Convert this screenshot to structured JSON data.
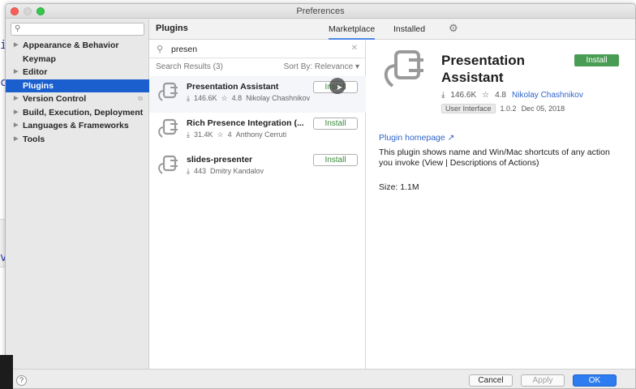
{
  "window": {
    "title": "Preferences"
  },
  "sidebar": {
    "search_placeholder": "",
    "items": [
      {
        "label": "Appearance & Behavior",
        "expandable": true
      },
      {
        "label": "Keymap",
        "expandable": false
      },
      {
        "label": "Editor",
        "expandable": true
      },
      {
        "label": "Plugins",
        "expandable": false,
        "selected": true
      },
      {
        "label": "Version Control",
        "expandable": true
      },
      {
        "label": "Build, Execution, Deployment",
        "expandable": true
      },
      {
        "label": "Languages & Frameworks",
        "expandable": true
      },
      {
        "label": "Tools",
        "expandable": true
      }
    ]
  },
  "plugins": {
    "title": "Plugins",
    "tabs": [
      {
        "label": "Marketplace",
        "active": true
      },
      {
        "label": "Installed",
        "active": false
      }
    ],
    "search_value": "presen",
    "results_count": "Search Results (3)",
    "sort_label": "Sort By: Relevance",
    "install_label": "Install",
    "results": [
      {
        "name": "Presentation Assistant",
        "downloads": "146.6K",
        "rating": "4.8",
        "vendor": "Nikolay Chashnikov"
      },
      {
        "name": "Rich Presence Integration (...",
        "downloads": "31.4K",
        "rating": "4",
        "vendor": "Anthony Cerruti"
      },
      {
        "name": "slides-presenter",
        "downloads": "443",
        "rating": "",
        "vendor": "Dmitry Kandalov"
      }
    ]
  },
  "detail": {
    "name": "Presentation Assistant",
    "install_label": "Install",
    "downloads": "146.6K",
    "rating": "4.8",
    "vendor": "Nikolay Chashnikov",
    "category": "User Interface",
    "version": "1.0.2",
    "date": "Dec 05, 2018",
    "homepage_label": "Plugin homepage",
    "description": "This plugin shows name and Win/Mac shortcuts of any action you invoke (View | Descriptions of Actions)",
    "size": "Size: 1.1M"
  },
  "footer": {
    "help": "?",
    "cancel": "Cancel",
    "apply": "Apply",
    "ok": "OK"
  },
  "colors": {
    "selection": "#1a5fcd",
    "install_green": "#499c54",
    "link": "#2f65ca",
    "ok_button": "#2d7cf0"
  }
}
